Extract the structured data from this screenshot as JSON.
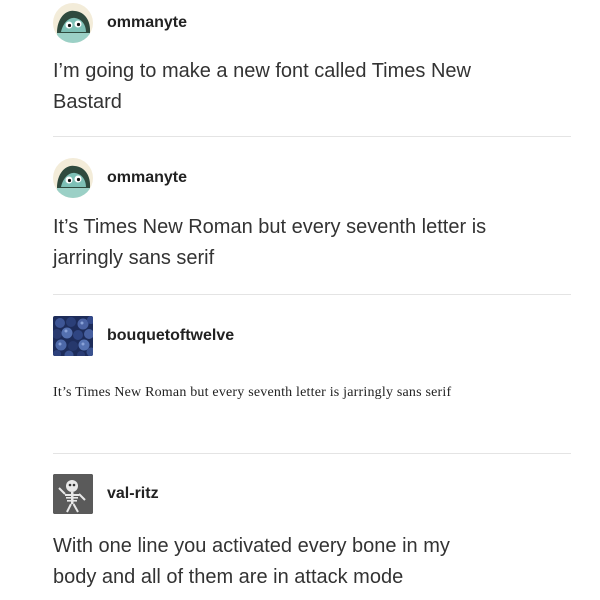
{
  "posts": [
    {
      "username": "ommanyte",
      "text_lines": [
        "I’m going to make a new font called Times New",
        "Bastard"
      ],
      "avatar_icon": "ghost-blob-icon"
    },
    {
      "username": "ommanyte",
      "text_lines": [
        "It’s Times New Roman but every seventh letter is",
        "jarringly sans serif"
      ],
      "avatar_icon": "ghost-blob-icon"
    },
    {
      "username": "bouquetoftwelve",
      "text_lines": [
        "It’s Times New Roman but every seventh letter is jarringly sans serif"
      ],
      "avatar_icon": "blueberries-icon"
    },
    {
      "username": "val-ritz",
      "text_lines": [
        "With one line you activated every bone in my",
        "body and all of them are in attack mode"
      ],
      "avatar_icon": "skeleton-icon"
    }
  ],
  "colors": {
    "text": "#333333",
    "username": "#222222",
    "divider": "#e4e4e4",
    "background": "#ffffff"
  }
}
